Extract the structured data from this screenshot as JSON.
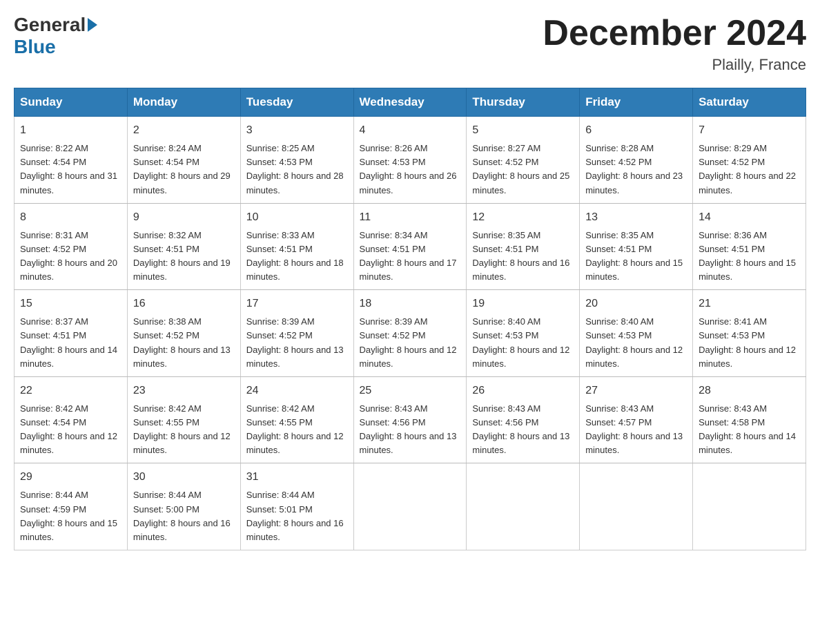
{
  "logo": {
    "general": "General",
    "blue": "Blue"
  },
  "title": "December 2024",
  "location": "Plailly, France",
  "days_of_week": [
    "Sunday",
    "Monday",
    "Tuesday",
    "Wednesday",
    "Thursday",
    "Friday",
    "Saturday"
  ],
  "weeks": [
    [
      {
        "day": "1",
        "sunrise": "8:22 AM",
        "sunset": "4:54 PM",
        "daylight": "8 hours and 31 minutes."
      },
      {
        "day": "2",
        "sunrise": "8:24 AM",
        "sunset": "4:54 PM",
        "daylight": "8 hours and 29 minutes."
      },
      {
        "day": "3",
        "sunrise": "8:25 AM",
        "sunset": "4:53 PM",
        "daylight": "8 hours and 28 minutes."
      },
      {
        "day": "4",
        "sunrise": "8:26 AM",
        "sunset": "4:53 PM",
        "daylight": "8 hours and 26 minutes."
      },
      {
        "day": "5",
        "sunrise": "8:27 AM",
        "sunset": "4:52 PM",
        "daylight": "8 hours and 25 minutes."
      },
      {
        "day": "6",
        "sunrise": "8:28 AM",
        "sunset": "4:52 PM",
        "daylight": "8 hours and 23 minutes."
      },
      {
        "day": "7",
        "sunrise": "8:29 AM",
        "sunset": "4:52 PM",
        "daylight": "8 hours and 22 minutes."
      }
    ],
    [
      {
        "day": "8",
        "sunrise": "8:31 AM",
        "sunset": "4:52 PM",
        "daylight": "8 hours and 20 minutes."
      },
      {
        "day": "9",
        "sunrise": "8:32 AM",
        "sunset": "4:51 PM",
        "daylight": "8 hours and 19 minutes."
      },
      {
        "day": "10",
        "sunrise": "8:33 AM",
        "sunset": "4:51 PM",
        "daylight": "8 hours and 18 minutes."
      },
      {
        "day": "11",
        "sunrise": "8:34 AM",
        "sunset": "4:51 PM",
        "daylight": "8 hours and 17 minutes."
      },
      {
        "day": "12",
        "sunrise": "8:35 AM",
        "sunset": "4:51 PM",
        "daylight": "8 hours and 16 minutes."
      },
      {
        "day": "13",
        "sunrise": "8:35 AM",
        "sunset": "4:51 PM",
        "daylight": "8 hours and 15 minutes."
      },
      {
        "day": "14",
        "sunrise": "8:36 AM",
        "sunset": "4:51 PM",
        "daylight": "8 hours and 15 minutes."
      }
    ],
    [
      {
        "day": "15",
        "sunrise": "8:37 AM",
        "sunset": "4:51 PM",
        "daylight": "8 hours and 14 minutes."
      },
      {
        "day": "16",
        "sunrise": "8:38 AM",
        "sunset": "4:52 PM",
        "daylight": "8 hours and 13 minutes."
      },
      {
        "day": "17",
        "sunrise": "8:39 AM",
        "sunset": "4:52 PM",
        "daylight": "8 hours and 13 minutes."
      },
      {
        "day": "18",
        "sunrise": "8:39 AM",
        "sunset": "4:52 PM",
        "daylight": "8 hours and 12 minutes."
      },
      {
        "day": "19",
        "sunrise": "8:40 AM",
        "sunset": "4:53 PM",
        "daylight": "8 hours and 12 minutes."
      },
      {
        "day": "20",
        "sunrise": "8:40 AM",
        "sunset": "4:53 PM",
        "daylight": "8 hours and 12 minutes."
      },
      {
        "day": "21",
        "sunrise": "8:41 AM",
        "sunset": "4:53 PM",
        "daylight": "8 hours and 12 minutes."
      }
    ],
    [
      {
        "day": "22",
        "sunrise": "8:42 AM",
        "sunset": "4:54 PM",
        "daylight": "8 hours and 12 minutes."
      },
      {
        "day": "23",
        "sunrise": "8:42 AM",
        "sunset": "4:55 PM",
        "daylight": "8 hours and 12 minutes."
      },
      {
        "day": "24",
        "sunrise": "8:42 AM",
        "sunset": "4:55 PM",
        "daylight": "8 hours and 12 minutes."
      },
      {
        "day": "25",
        "sunrise": "8:43 AM",
        "sunset": "4:56 PM",
        "daylight": "8 hours and 13 minutes."
      },
      {
        "day": "26",
        "sunrise": "8:43 AM",
        "sunset": "4:56 PM",
        "daylight": "8 hours and 13 minutes."
      },
      {
        "day": "27",
        "sunrise": "8:43 AM",
        "sunset": "4:57 PM",
        "daylight": "8 hours and 13 minutes."
      },
      {
        "day": "28",
        "sunrise": "8:43 AM",
        "sunset": "4:58 PM",
        "daylight": "8 hours and 14 minutes."
      }
    ],
    [
      {
        "day": "29",
        "sunrise": "8:44 AM",
        "sunset": "4:59 PM",
        "daylight": "8 hours and 15 minutes."
      },
      {
        "day": "30",
        "sunrise": "8:44 AM",
        "sunset": "5:00 PM",
        "daylight": "8 hours and 16 minutes."
      },
      {
        "day": "31",
        "sunrise": "8:44 AM",
        "sunset": "5:01 PM",
        "daylight": "8 hours and 16 minutes."
      },
      null,
      null,
      null,
      null
    ]
  ],
  "labels": {
    "sunrise": "Sunrise:",
    "sunset": "Sunset:",
    "daylight": "Daylight:"
  }
}
